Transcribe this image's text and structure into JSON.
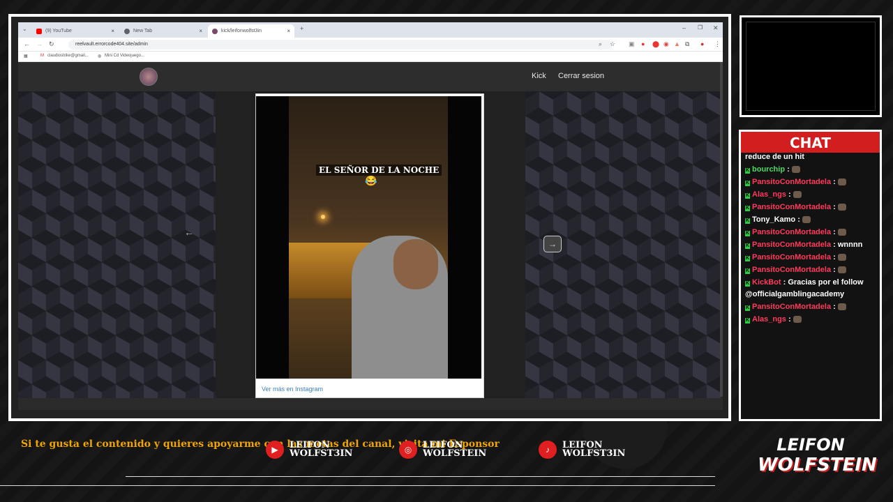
{
  "browser": {
    "tabs": [
      {
        "label": "(9) YouTube",
        "icon": "youtube-icon",
        "icon_color": "#ff0000"
      },
      {
        "label": "New Tab",
        "icon": "chrome-icon",
        "icon_color": "#5f6368"
      },
      {
        "label": "kick/leifonwolfst3in",
        "icon": "site-icon",
        "icon_color": "#7a4a6a"
      }
    ],
    "url": "reelvault.errorcode404.site/admin",
    "bookmarks": [
      "claudiostrike@gmail...",
      "Mini Cd Videojuego..."
    ]
  },
  "site": {
    "nav": {
      "kick": "Kick",
      "logout": "Cerrar sesion"
    },
    "video_caption": "EL SEÑOR DE LA NOCHE",
    "video_emoji": "😂",
    "instagram_link": "Ver más en Instagram"
  },
  "chat": {
    "title": "CHAT",
    "messages": [
      {
        "user": "",
        "text": "reduce de un hit",
        "user_color": ""
      },
      {
        "user": "bourchip",
        "text": "",
        "user_color": "#4cd964"
      },
      {
        "user": "PansitoConMortadela",
        "text": "",
        "user_color": "#ff3b5c"
      },
      {
        "user": "Alas_ngs",
        "text": "",
        "user_color": "#ff3b5c"
      },
      {
        "user": "PansitoConMortadela",
        "text": "",
        "user_color": "#ff3b5c"
      },
      {
        "user": "Tony_Kamo",
        "text": "",
        "user_color": "#ffffff"
      },
      {
        "user": "PansitoConMortadela",
        "text": "",
        "user_color": "#ff3b5c"
      },
      {
        "user": "PansitoConMortadela",
        "text": "wnnnn",
        "user_color": "#ff3b5c"
      },
      {
        "user": "PansitoConMortadela",
        "text": "",
        "user_color": "#ff3b5c"
      },
      {
        "user": "PansitoConMortadela",
        "text": "",
        "user_color": "#ff3b5c"
      },
      {
        "user": "KickBot",
        "text": "Gracias por el follow @officialgamblingacademy",
        "user_color": "#ff3b5c"
      },
      {
        "user": "PansitoConMortadela",
        "text": "",
        "user_color": "#ff3b5c"
      },
      {
        "user": "Alas_ngs",
        "text": "",
        "user_color": "#ff3b5c"
      }
    ]
  },
  "footer": {
    "sponsor": "Si te gusta el contenido y quieres apoyarme con las metas del canal, visita mi Esponsor",
    "socials": [
      {
        "icon": "youtube-icon",
        "line1": "LEIFON",
        "line2": "WOLFST3IN"
      },
      {
        "icon": "instagram-icon",
        "line1": "LEIFON",
        "line2": "WOLFSTEIN"
      },
      {
        "icon": "tiktok-icon",
        "line1": "LEIFON",
        "line2": "WOLFST3IN"
      }
    ],
    "logo": {
      "line1": "LEIFON",
      "line2": "WOLFSTEIN"
    }
  },
  "colors": {
    "accent": "#d21e1e",
    "sponsor_text": "#f0a500",
    "kick_green": "#2ecc40"
  }
}
